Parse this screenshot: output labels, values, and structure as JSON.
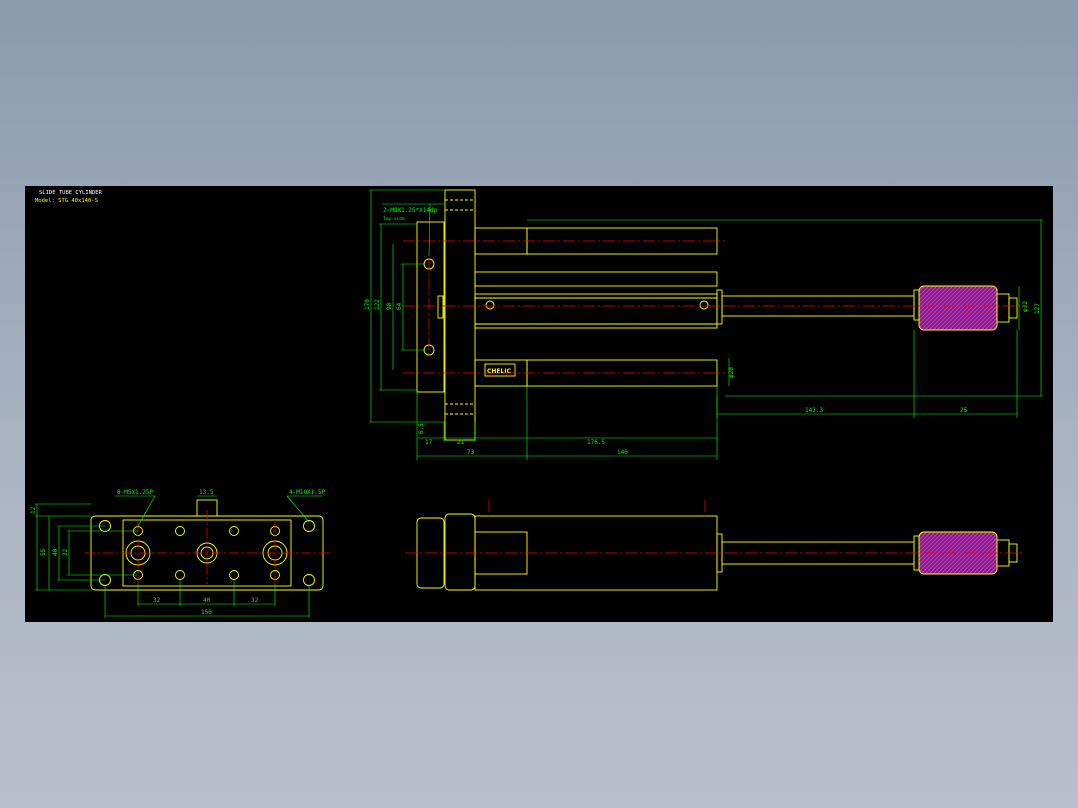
{
  "title": "SLIDE TUBE CYLINDER",
  "model": "Model:  STG 40x140-S",
  "brand": "CHELIC",
  "colors": {
    "background": "#000000",
    "outline": "#ffff00",
    "dimension": "#00ff00",
    "centerline": "#ff0000",
    "hatch": "#c030c0"
  },
  "callouts": {
    "top_holes": "2-M8X1.25*X14dp",
    "top_holes_sub": "Top side",
    "bottom_holes": "8-M5X1.25P",
    "bottom_pitch": "13.5",
    "bottom_right": "4-M10X1.5P"
  },
  "side_view": {
    "dims": {
      "h170": "170",
      "h122": "122",
      "h98": "98",
      "h64": "64",
      "h127": "127",
      "phi32": "φ32",
      "phi20": "φ20",
      "d143": "143.3",
      "d25": "25",
      "d6": "6.5",
      "d17": "17",
      "d21": "21",
      "d176": "176.5",
      "d73": "73",
      "d140": "140"
    }
  },
  "bottom_view": {
    "dims": {
      "v12": "12",
      "v55": "55",
      "v40": "40",
      "v32": "32",
      "h32a": "32",
      "h40": "40",
      "h32b": "32",
      "h150": "150"
    }
  }
}
